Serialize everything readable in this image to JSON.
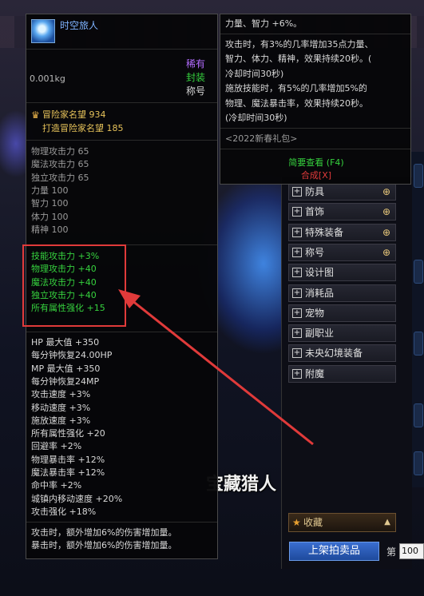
{
  "background": {
    "overlay_text": "宝藏猎人"
  },
  "item": {
    "name": "时空旅人",
    "weight": "0.001kg",
    "rarity": "稀有",
    "sealed": "封装",
    "type": "称号",
    "fame": "冒险家名望 934",
    "fame_sub": "打造冒险家名望 185",
    "base_stats": [
      "物理攻击力 65",
      "魔法攻击力 65",
      "独立攻击力 65",
      "力量 100",
      "智力 100",
      "体力 100",
      "精神 100"
    ],
    "bonus_stats": [
      "技能攻击力 +3%",
      "物理攻击力 +40",
      "魔法攻击力 +40",
      "独立攻击力 +40",
      "所有属性强化 +15"
    ],
    "extra_stats": [
      "HP 最大值 +350",
      "每分钟恢复24.00HP",
      "MP 最大值 +350",
      "每分钟恢复24MP",
      "攻击速度 +3%",
      "移动速度 +3%",
      "施放速度 +3%",
      "所有属性强化 +20",
      "回避率 +2%",
      "物理暴击率 +12%",
      "魔法暴击率 +12%",
      "命中率 +2%",
      "城镇内移动速度 +20%",
      "攻击强化 +18%"
    ],
    "effects": [
      "攻击时，额外增加6%的伤害增加量。",
      "暴击时，额外增加6%的伤害增加量。"
    ],
    "colors": {
      "name": "#7fb3ff",
      "rarity": "#b36cff",
      "sealed": "#36d23e",
      "bonus": "#36d23e",
      "highlight": "#e03a3a"
    }
  },
  "tooltip2": {
    "head": "力量、智力 +6%。",
    "lines": [
      "攻击时，有3%的几率增加35点力量、",
      "智力、体力、精神，效果持续20秒。(",
      "冷却时间30秒)",
      "施放技能时，有5%的几率增加5%的",
      "物理、魔法暴击率，效果持续20秒。",
      "(冷却时间30秒)"
    ],
    "pack": "<2022新春礼包>",
    "view": "简要查看 (F4)",
    "compose": "合成[X]"
  },
  "menu": {
    "items": [
      {
        "label": "防具",
        "icon": "magnifier-plus-icon"
      },
      {
        "label": "首饰",
        "icon": "magnifier-plus-icon"
      },
      {
        "label": "特殊装备",
        "icon": "magnifier-plus-icon"
      },
      {
        "label": "称号",
        "icon": "magnifier-plus-icon"
      },
      {
        "label": "设计图"
      },
      {
        "label": "消耗品"
      },
      {
        "label": "宠物"
      },
      {
        "label": "副职业"
      },
      {
        "label": "未央幻境装备"
      },
      {
        "label": "附魔"
      }
    ],
    "favorites": "收藏",
    "sell_button": "上架拍卖品",
    "page_label": "第",
    "page_value": "100"
  }
}
